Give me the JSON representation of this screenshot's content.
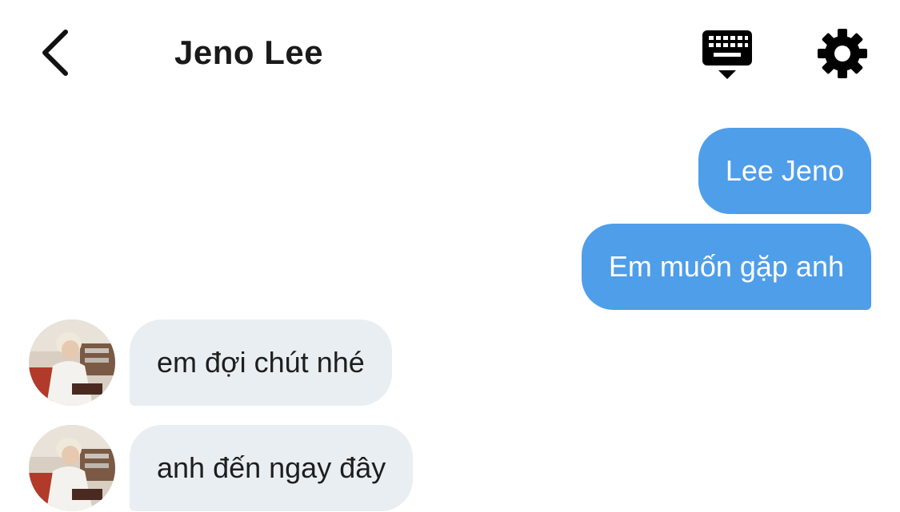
{
  "header": {
    "title": "Jeno Lee",
    "back_icon": "chevron-left-icon",
    "keyboard_icon": "keyboard-icon",
    "settings_icon": "gear-icon"
  },
  "messages": [
    {
      "direction": "outgoing",
      "text": "Lee Jeno"
    },
    {
      "direction": "outgoing",
      "text": "Em muốn gặp anh"
    },
    {
      "direction": "incoming",
      "text": "em đợi chút nhé"
    },
    {
      "direction": "incoming",
      "text": "anh đến ngay đây"
    }
  ],
  "colors": {
    "outgoing_bubble": "#4f9ee9",
    "incoming_bubble": "#e9eef2",
    "outgoing_text": "#ffffff",
    "incoming_text": "#1e1e1e"
  }
}
